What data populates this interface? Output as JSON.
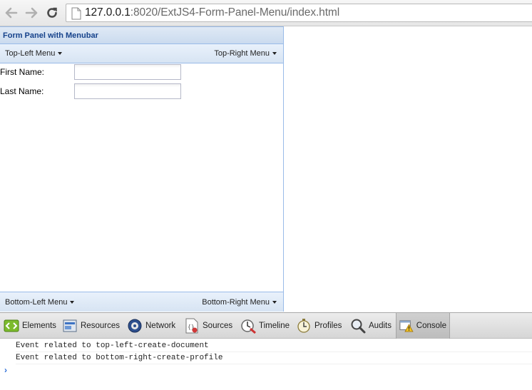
{
  "browser": {
    "url_host": "127.0.0.1",
    "url_rest": ":8020/ExtJS4-Form-Panel-Menu/index.html"
  },
  "panel": {
    "title": "Form Panel with Menubar",
    "top_left_menu": "Top-Left Menu",
    "top_right_menu": "Top-Right Menu",
    "bottom_left_menu": "Bottom-Left Menu",
    "bottom_right_menu": "Bottom-Right Menu",
    "fields": [
      {
        "label": "First Name:",
        "value": ""
      },
      {
        "label": "Last Name:",
        "value": ""
      }
    ]
  },
  "devtools": {
    "tabs": [
      "Elements",
      "Resources",
      "Network",
      "Sources",
      "Timeline",
      "Profiles",
      "Audits",
      "Console"
    ],
    "active_tab": "Console"
  },
  "console": {
    "lines": [
      "Event related to top-left-create-document",
      "Event related to bottom-right-create-profile"
    ],
    "prompt": "›"
  }
}
